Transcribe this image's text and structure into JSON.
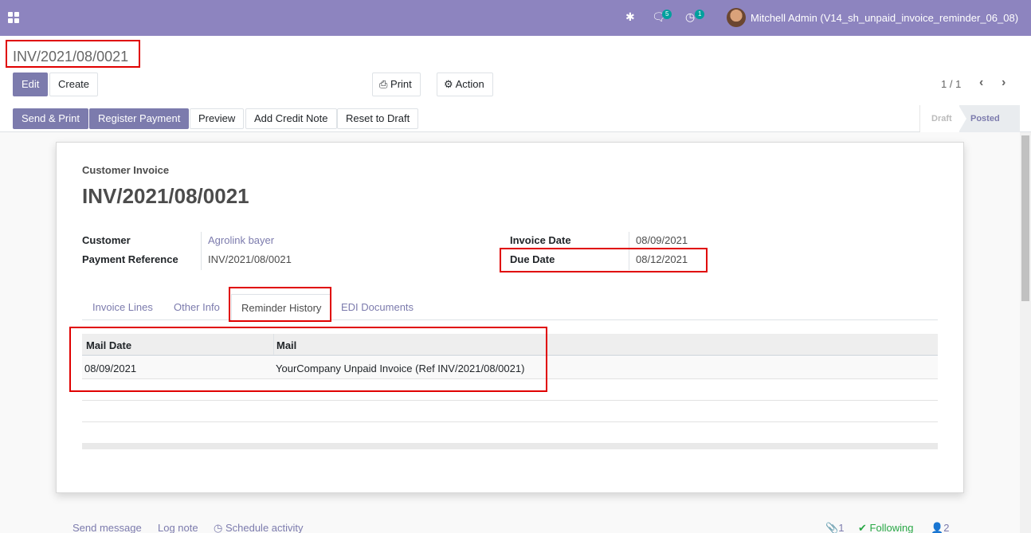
{
  "navbar": {
    "notifications": {
      "messages_count": "5",
      "activities_count": "1"
    },
    "user": "Mitchell Admin (V14_sh_unpaid_invoice_reminder_06_08)"
  },
  "breadcrumb": {
    "title": "INV/2021/08/0021"
  },
  "control": {
    "edit_label": "Edit",
    "create_label": "Create",
    "print_label": "Print",
    "action_label": "Action",
    "pager": "1 / 1"
  },
  "header_buttons": {
    "send_print": "Send & Print",
    "register_payment": "Register Payment",
    "preview": "Preview",
    "add_credit_note": "Add Credit Note",
    "reset_to_draft": "Reset to Draft"
  },
  "statusbar": {
    "draft": "Draft",
    "posted": "Posted"
  },
  "sheet": {
    "doc_type": "Customer Invoice",
    "doc_name": "INV/2021/08/0021",
    "fields": {
      "customer_label": "Customer",
      "customer_value": "Agrolink bayer",
      "payment_ref_label": "Payment Reference",
      "payment_ref_value": "INV/2021/08/0021",
      "invoice_date_label": "Invoice Date",
      "invoice_date_value": "08/09/2021",
      "due_date_label": "Due Date",
      "due_date_value": "08/12/2021"
    },
    "tabs": [
      "Invoice Lines",
      "Other Info",
      "Reminder History",
      "EDI Documents"
    ],
    "table": {
      "headers": [
        "Mail Date",
        "Mail"
      ],
      "rows": [
        {
          "mail_date": "08/09/2021",
          "mail": "YourCompany Unpaid Invoice (Ref INV/2021/08/0021)"
        }
      ]
    }
  },
  "chatter": {
    "send_message": "Send message",
    "log_note": "Log note",
    "schedule_activity": "Schedule activity",
    "attachments": "1",
    "following": "Following",
    "followers": "2"
  }
}
